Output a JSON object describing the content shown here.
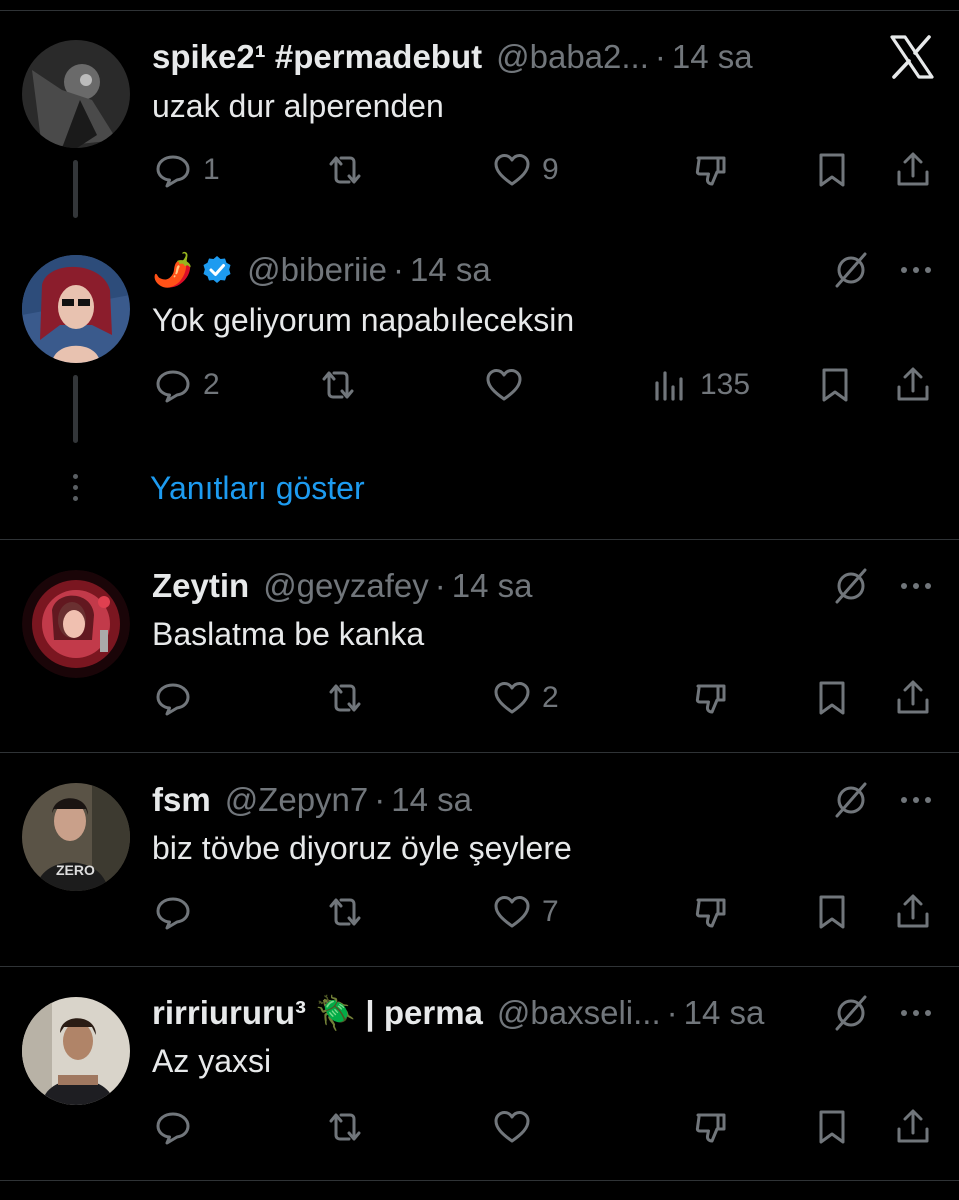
{
  "tweets": [
    {
      "name": "spike2¹ #permadebut",
      "handle": "@baba2...",
      "time": "14 sa",
      "text": "uzak dur alperenden",
      "replies": "1",
      "retweets": "",
      "likes": "9",
      "fourth": "dislike",
      "fourth_value": ""
    },
    {
      "name": "🌶️",
      "verified": true,
      "handle": "@biberiie",
      "time": "14 sa",
      "text": "Yok geliyorum napabıleceksin",
      "replies": "2",
      "retweets": "",
      "likes": "",
      "fourth": "views",
      "fourth_value": "135"
    },
    {
      "name": "Zeytin",
      "handle": "@geyzafey",
      "time": "14 sa",
      "text": "Baslatma be kanka",
      "replies": "",
      "retweets": "",
      "likes": "2",
      "fourth": "dislike",
      "fourth_value": ""
    },
    {
      "name": "fsm",
      "handle": "@Zepyn7",
      "time": "14 sa",
      "text": "biz tövbe diyoruz öyle şeylere",
      "replies": "",
      "retweets": "",
      "likes": "7",
      "fourth": "dislike",
      "fourth_value": ""
    },
    {
      "name": "rirriururu³ 🪲 | perma",
      "handle": "@baxseli...",
      "time": "14 sa",
      "text": "Az yaxsi",
      "replies": "",
      "retweets": "",
      "likes": "",
      "fourth": "dislike",
      "fourth_value": ""
    }
  ],
  "show_replies_label": "Yanıtları göster",
  "colors": {
    "background": "#000000",
    "text": "#e7e9ea",
    "muted": "#71767b",
    "link": "#1d9bf0",
    "verified": "#1d9bf0",
    "divider": "#2f3336"
  }
}
